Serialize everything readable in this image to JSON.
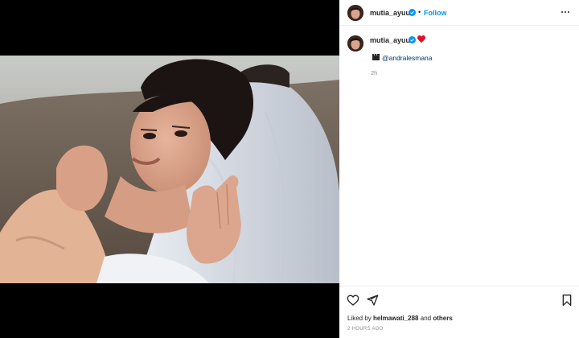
{
  "post": {
    "author": "mutia_ayuu",
    "follow_label": "Follow",
    "separator": "•",
    "caption_mention": "@andralesmana",
    "caption_time": "2h",
    "liked_prefix": "Liked by",
    "liked_user": "helmawati_288",
    "liked_and": "and",
    "liked_others": "others",
    "date": "2 HOURS AGO"
  },
  "icons": {
    "verified": "verified-badge-icon",
    "heart_emoji": "red-heart-icon",
    "clapper": "clapper-board-icon",
    "like": "heart-outline-icon",
    "share": "paper-plane-icon",
    "save": "bookmark-icon",
    "more": "more-options-icon"
  },
  "colors": {
    "link": "#0095f6",
    "verified": "#0095f6",
    "mention": "#00376b",
    "muted": "#8e8e8e",
    "heart": "#ed4956"
  }
}
